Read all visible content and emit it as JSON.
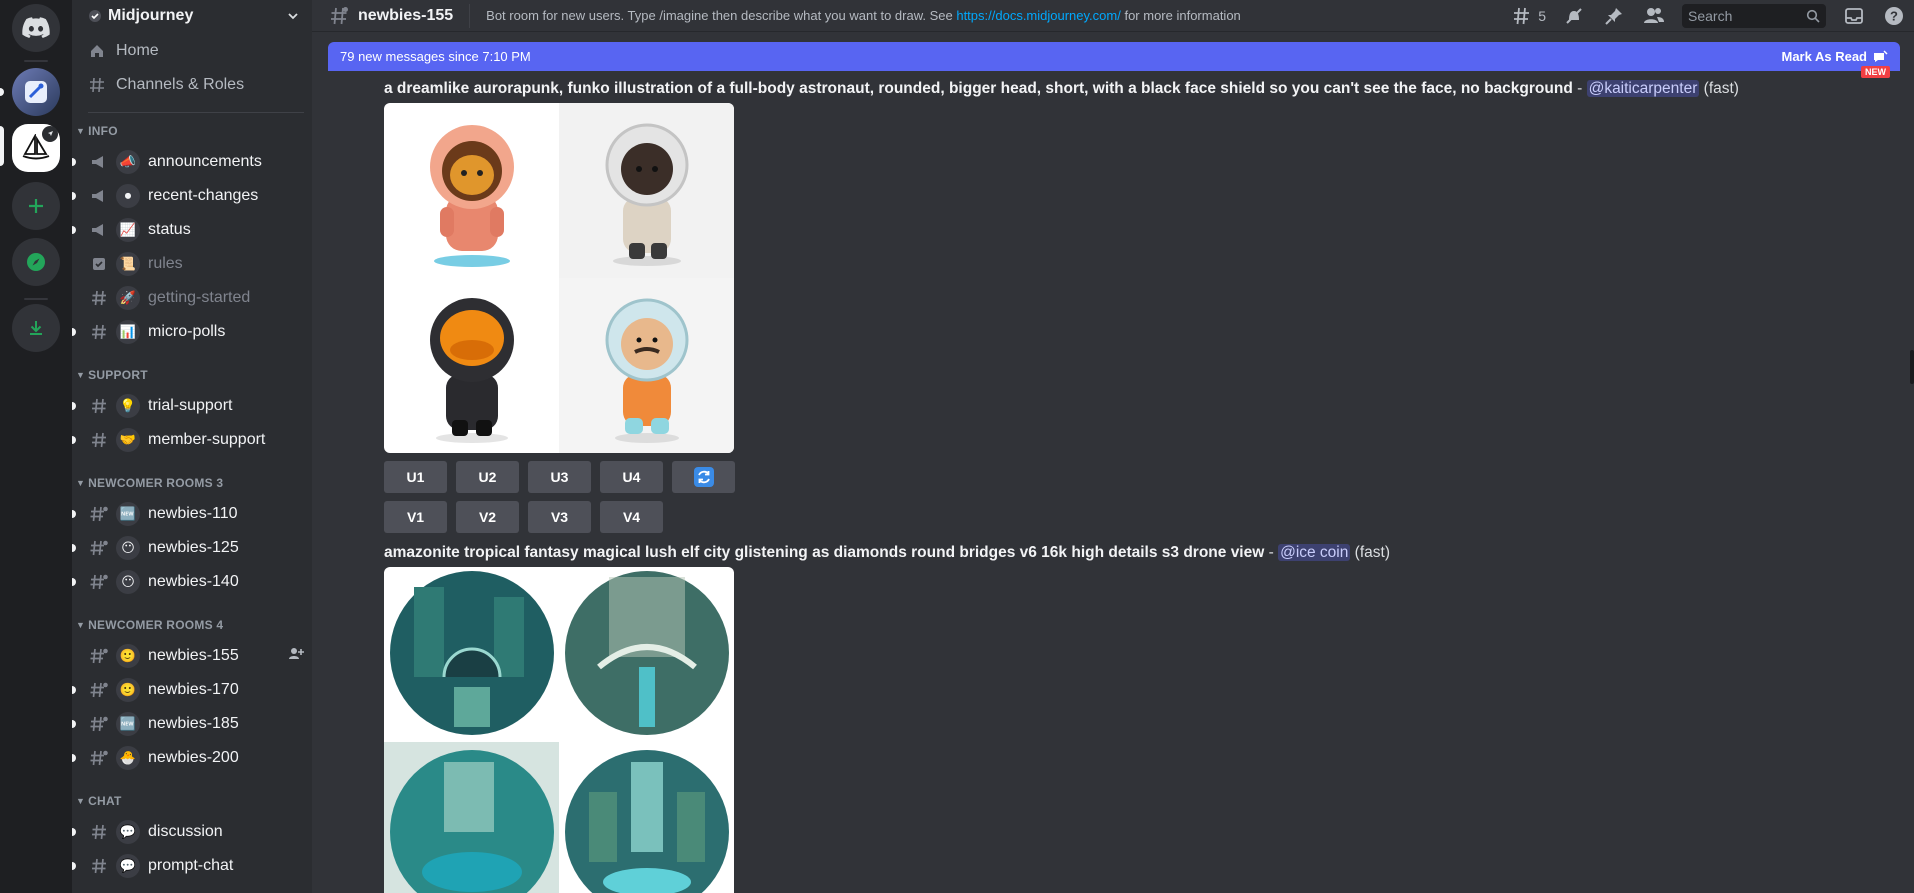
{
  "server": {
    "name": "Midjourney"
  },
  "sidebar": {
    "top_items": [
      {
        "label": "Home"
      },
      {
        "label": "Channels & Roles"
      }
    ],
    "categories": [
      {
        "label": "INFO",
        "channels": [
          {
            "label": "announcements",
            "emoji": "📣"
          },
          {
            "label": "recent-changes",
            "emoji": "⏺"
          },
          {
            "label": "status",
            "emoji": "📈"
          },
          {
            "label": "rules",
            "emoji": "📜"
          },
          {
            "label": "getting-started",
            "emoji": "🚀"
          },
          {
            "label": "micro-polls",
            "emoji": "📊"
          }
        ]
      },
      {
        "label": "SUPPORT",
        "channels": [
          {
            "label": "trial-support",
            "emoji": "💡"
          },
          {
            "label": "member-support",
            "emoji": "🤝"
          }
        ]
      },
      {
        "label": "NEWCOMER ROOMS 3",
        "channels": [
          {
            "label": "newbies-110",
            "emoji": "🆕"
          },
          {
            "label": "newbies-125",
            "emoji": "😶"
          },
          {
            "label": "newbies-140",
            "emoji": "😶"
          }
        ]
      },
      {
        "label": "NEWCOMER ROOMS 4",
        "channels": [
          {
            "label": "newbies-155",
            "emoji": "🙂"
          },
          {
            "label": "newbies-170",
            "emoji": "🙂"
          },
          {
            "label": "newbies-185",
            "emoji": "🆕"
          },
          {
            "label": "newbies-200",
            "emoji": "🐣"
          }
        ]
      },
      {
        "label": "CHAT",
        "channels": [
          {
            "label": "discussion",
            "emoji": "💬"
          },
          {
            "label": "prompt-chat",
            "emoji": "💬"
          }
        ]
      }
    ]
  },
  "header": {
    "channel": "newbies-155",
    "topic_pre": "Bot room for new users. Type /imagine then describe what you want to draw. See ",
    "topic_link": "https://docs.midjourney.com/",
    "topic_post": " for more information",
    "threads_count": "5",
    "search_placeholder": "Search"
  },
  "new_messages": {
    "text": "79 new messages since 7:10 PM",
    "mark_read": "Mark As Read",
    "flag": "NEW"
  },
  "messages": [
    {
      "prompt": "a dreamlike aurorapunk, funko illustration of a full-body astronaut, rounded, bigger head, short, with a black face shield so you can't see the face, no background",
      "sep": " - ",
      "user": "@kaiticarpenter",
      "mode": " (fast)",
      "buttons_u": [
        "U1",
        "U2",
        "U3",
        "U4"
      ],
      "buttons_v": [
        "V1",
        "V2",
        "V3",
        "V4"
      ]
    },
    {
      "prompt": "amazonite tropical fantasy magical lush elf city glistening as diamonds round bridges v6 16k high details s3 drone view",
      "sep": " - ",
      "user": "@ice coin",
      "mode": " (fast)"
    }
  ],
  "colors": {
    "accent": "#5865f2",
    "link": "#00a8fc",
    "rail": "#1e1f22",
    "sidebar": "#2b2d31",
    "main": "#313338"
  }
}
